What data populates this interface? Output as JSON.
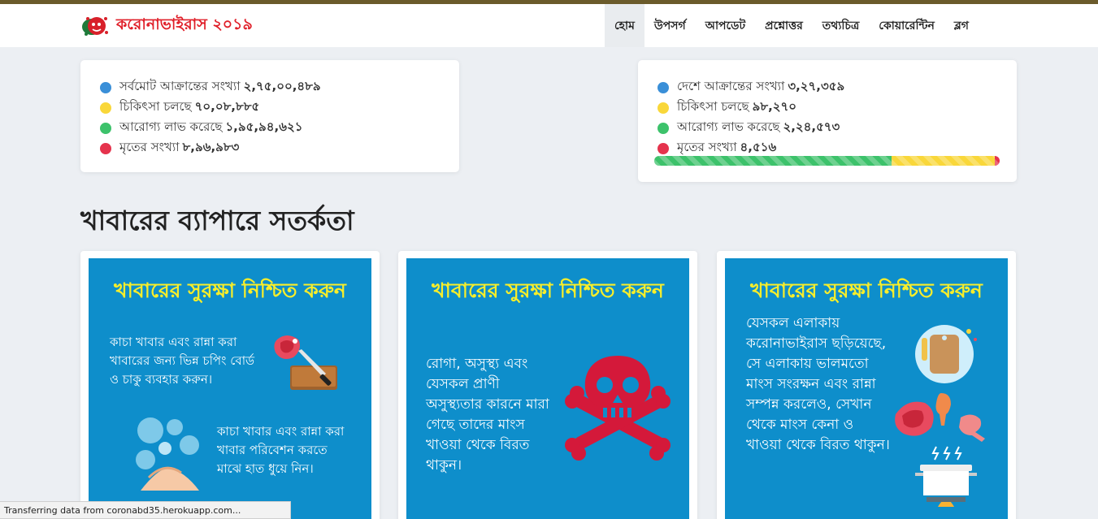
{
  "brand": {
    "name": "করোনাভাইরাস ২০১৯",
    "logo_icon": "coronavirus-logo-icon",
    "color": "#e0202a"
  },
  "nav": [
    {
      "label": "হোম",
      "active": true
    },
    {
      "label": "উপসর্গ"
    },
    {
      "label": "আপডেট"
    },
    {
      "label": "প্রশ্নোত্তর"
    },
    {
      "label": "তথ্যচিত্র"
    },
    {
      "label": "কোয়ারেন্টিন"
    },
    {
      "label": "ব্লগ"
    }
  ],
  "global_stats": [
    {
      "label": "সর্বমোট আক্রান্তের সংখ্যা",
      "value": "২,৭৫,০০,৪৮৯",
      "color": "#3a8fd8"
    },
    {
      "label": "চিকিৎসা চলছে",
      "value": "৭০,০৮,৮৮৫",
      "color": "#f9d73a"
    },
    {
      "label": "আরোগ্য লাভ করেছে",
      "value": "১,৯৫,৯৪,৬২১",
      "color": "#3dc26b"
    },
    {
      "label": "মৃতের সংখ্যা",
      "value": "৮,৯৬,৯৮৩",
      "color": "#e5334d"
    }
  ],
  "country_stats": [
    {
      "label": "দেশে আক্রান্তের সংখ্যা",
      "value": "৩,২৭,৩৫৯",
      "color": "#3a8fd8"
    },
    {
      "label": "চিকিৎসা চলছে",
      "value": "৯৮,২৭০",
      "color": "#f9d73a"
    },
    {
      "label": "আরোগ্য লাভ করেছে",
      "value": "২,২৪,৫৭৩",
      "color": "#3dc26b"
    },
    {
      "label": "মৃতের সংখ্যা",
      "value": "৪,৫১৬",
      "color": "#e5334d"
    }
  ],
  "country_progress": [
    {
      "name": "recovered",
      "fraction": 0.686,
      "color": "#3dc26b"
    },
    {
      "name": "active",
      "fraction": 0.3,
      "color": "#f9d73a"
    },
    {
      "name": "deaths",
      "fraction": 0.014,
      "color": "#e5334d"
    }
  ],
  "section_title": "খাবারের ব্যাপারে সতর্কতা",
  "cards": [
    {
      "title": "খাবারের সুরক্ষা নিশ্চিত করুন",
      "text1": "কাচা খাবার এবং রান্না করা খাবারের জন্য ভিন্ন চপিং বোর্ড ও চাকু ব্যবহার করুন।",
      "text2": "কাচা খাবার এবং রান্না করা খাবার পরিবেশন করতে মাঝে হাত ধুয়ে নিন।",
      "icons": [
        "meat-icon",
        "chopping-board-knife-icon",
        "hand-washing-icon"
      ]
    },
    {
      "title": "খাবারের সুরক্ষা নিশ্চিত করুন",
      "text1": "রোগা, অসুস্থ্য এবং যেসকল প্রাণী অসুস্থ্যতার কারনে মারা গেছে তাদের মাংস খাওয়া থেকে বিরত থাকুন।",
      "icons": [
        "skull-crossbones-icon"
      ]
    },
    {
      "title": "খাবারের সুরক্ষা নিশ্চিত করুন",
      "text1": "যেসকল এলাকায় করোনাভাইরাস ছড়িয়েছে, সে এলাকায় ভালমতো মাংস সংরক্ষন এবং রান্না সম্পন্ন করলেও, সেখান থেকে মাংস কেনা ও খাওয়া থেকে বিরত থাকুন।",
      "icons": [
        "cutting-board-icon",
        "meat-chicken-icon",
        "cooking-pot-icon"
      ]
    }
  ],
  "card_colors": {
    "background": "#0e8ecb",
    "title": "#f8ee2a"
  },
  "status_bar": "Transferring data from coronabd35.herokuapp.com..."
}
